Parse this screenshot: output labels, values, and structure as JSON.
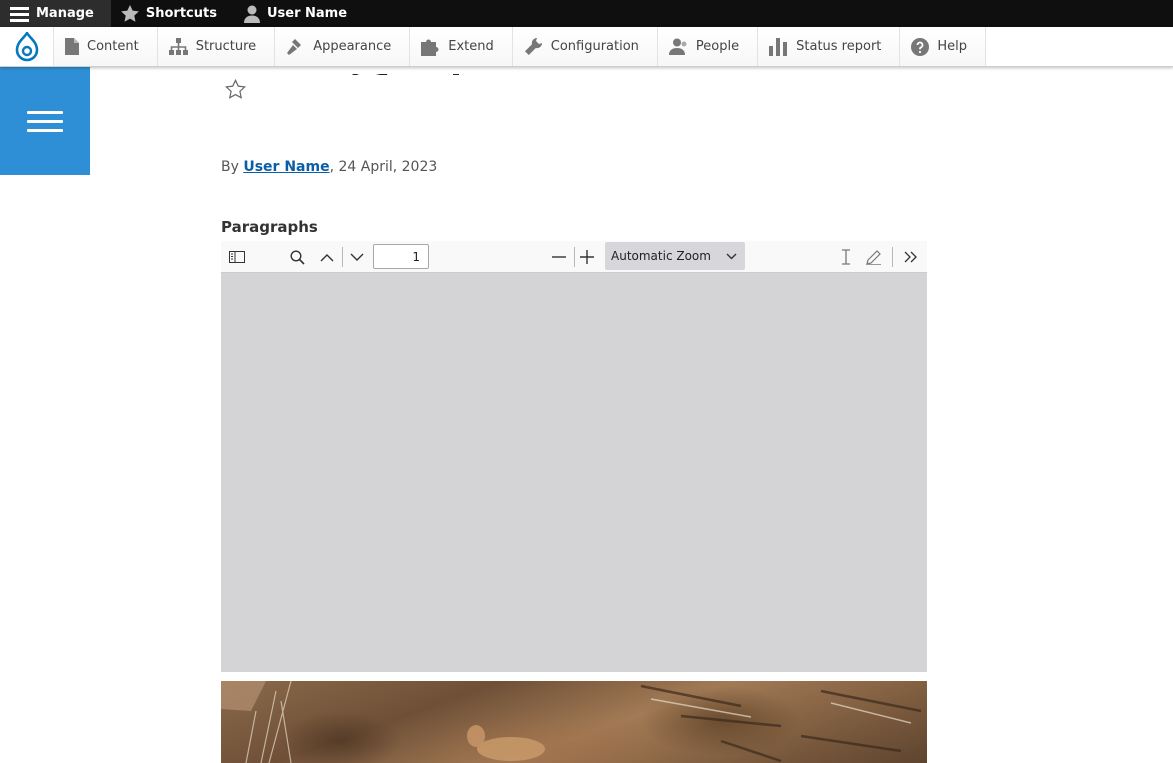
{
  "toolbar": {
    "manage_label": "Manage",
    "shortcuts_label": "Shortcuts",
    "user_label": "User Name"
  },
  "tray": {
    "items": [
      {
        "label": "Content"
      },
      {
        "label": "Structure"
      },
      {
        "label": "Appearance"
      },
      {
        "label": "Extend"
      },
      {
        "label": "Configuration"
      },
      {
        "label": "People"
      },
      {
        "label": "Status report"
      },
      {
        "label": "Help"
      }
    ]
  },
  "article": {
    "by_prefix": "By ",
    "author": "User Name",
    "date_suffix": ", 24 April, 2023",
    "section_label": "Paragraphs"
  },
  "pdf_viewer": {
    "page_number": "1",
    "zoom_label": "Automatic Zoom"
  },
  "colors": {
    "toolbar_bg": "#0f0f0f",
    "accent_blue": "#2f8fd6",
    "link": "#0a5ea8",
    "pdf_canvas": "#d4d4d7"
  }
}
